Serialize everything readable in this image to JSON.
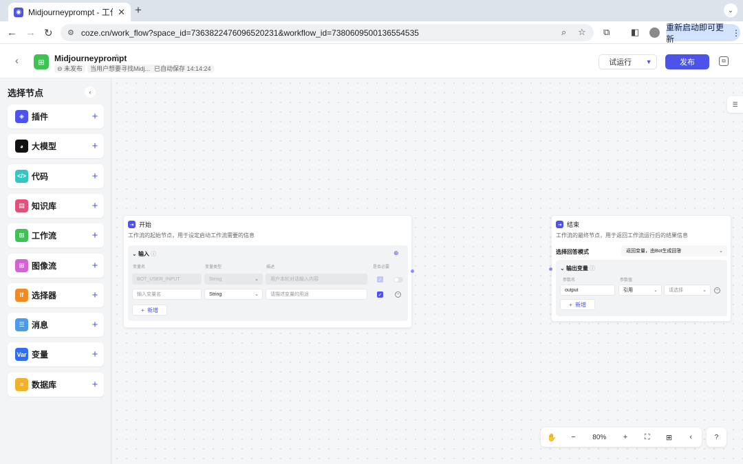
{
  "browser": {
    "tab_title": "Midjourneyprompt - 工作流 - ",
    "url_host": "coze.cn",
    "url_path": "/work_flow?space_id=7363822476096520231&workflow_id=7380609500136554535",
    "update_label": "重新启动即可更新"
  },
  "header": {
    "app_name": "Midjourneyprompt",
    "status": "未发布",
    "description": "当用户想要寻找Midj...",
    "autosave": "已自动保存 14:14:24",
    "run_label": "试运行",
    "publish_label": "发布"
  },
  "sidebar": {
    "title": "选择节点",
    "items": [
      {
        "label": "插件",
        "icon": "plugin-icon",
        "color": "#4d53e8",
        "glyph": "◈"
      },
      {
        "label": "大模型",
        "icon": "llm-icon",
        "color": "#111111",
        "glyph": "◕"
      },
      {
        "label": "代码",
        "icon": "code-icon",
        "color": "#36c5c5",
        "glyph": "</>"
      },
      {
        "label": "知识库",
        "icon": "knowledge-icon",
        "color": "#e0527a",
        "glyph": "▤"
      },
      {
        "label": "工作流",
        "icon": "workflow-icon",
        "color": "#3ec254",
        "glyph": "⊞"
      },
      {
        "label": "图像流",
        "icon": "imageflow-icon",
        "color": "#d860d8",
        "glyph": "⊞"
      },
      {
        "label": "选择器",
        "icon": "selector-icon",
        "color": "#f08a24",
        "glyph": "If"
      },
      {
        "label": "消息",
        "icon": "message-icon",
        "color": "#4a9bf0",
        "glyph": "☰"
      },
      {
        "label": "变量",
        "icon": "variable-icon",
        "color": "#2f6ef0",
        "glyph": "Var"
      },
      {
        "label": "数据库",
        "icon": "database-icon",
        "color": "#f2b12c",
        "glyph": "≡"
      }
    ]
  },
  "start_node": {
    "title": "开始",
    "description": "工作流的起始节点，用于设定启动工作流需要的信息",
    "section_title": "输入",
    "columns": [
      "变量名",
      "变量类型",
      "描述",
      "是否必要"
    ],
    "row1": {
      "name": "BOT_USER_INPUT",
      "type": "String",
      "desc_placeholder": "用户本轮对话输入内容"
    },
    "row2": {
      "name_placeholder": "输入变量名",
      "type": "String",
      "desc_placeholder": "请描述变量的用途"
    },
    "add_label": "新增"
  },
  "end_node": {
    "title": "结束",
    "description": "工作流的最终节点，用于返回工作流运行后的结果信息",
    "mode_label": "选择回答模式",
    "mode_value": "返回变量，由Bot生成回答",
    "section_title": "输出变量",
    "columns": [
      "参数名",
      "参数值"
    ],
    "row1": {
      "name": "output",
      "ref": "引用",
      "select_placeholder": "请选择"
    },
    "add_label": "新增"
  },
  "zoom": {
    "value": "80%"
  }
}
